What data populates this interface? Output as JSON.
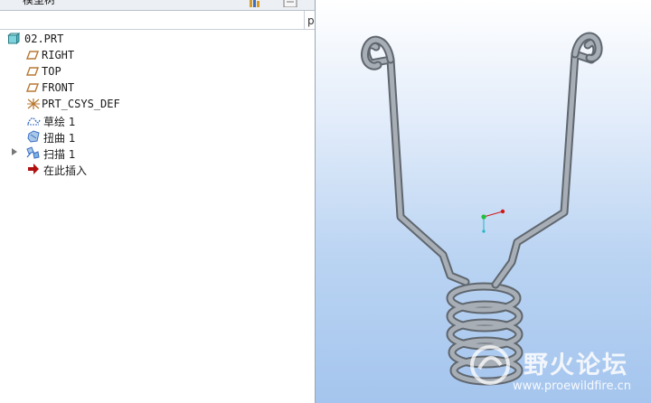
{
  "panel": {
    "title": "模型树",
    "column_label": "p"
  },
  "tree": [
    {
      "label": "02.PRT",
      "icon": "part-icon",
      "level": 0,
      "expandable": false
    },
    {
      "label": "RIGHT",
      "icon": "datum-plane-icon",
      "level": 1,
      "expandable": false
    },
    {
      "label": "TOP",
      "icon": "datum-plane-icon",
      "level": 1,
      "expandable": false
    },
    {
      "label": "FRONT",
      "icon": "datum-plane-icon",
      "level": 1,
      "expandable": false
    },
    {
      "label": "PRT_CSYS_DEF",
      "icon": "coordinate-system-icon",
      "level": 1,
      "expandable": false
    },
    {
      "label": "草绘 1",
      "icon": "sketch-icon",
      "level": 1,
      "expandable": false
    },
    {
      "label": "扭曲 1",
      "icon": "warp-icon",
      "level": 1,
      "expandable": false
    },
    {
      "label": "扫描 1",
      "icon": "sweep-icon",
      "level": 1,
      "expandable": true
    },
    {
      "label": "在此插入",
      "icon": "insert-here-arrow-icon",
      "level": 1,
      "expandable": false
    }
  ],
  "watermark": {
    "brand": "野火论坛",
    "url": "www.proewildfire.cn"
  },
  "colors": {
    "viewport_bottom": "#a5c5ee",
    "model_steel": "#8d949c",
    "datum_plane": "#b87833",
    "insert_arrow": "#b01010"
  }
}
